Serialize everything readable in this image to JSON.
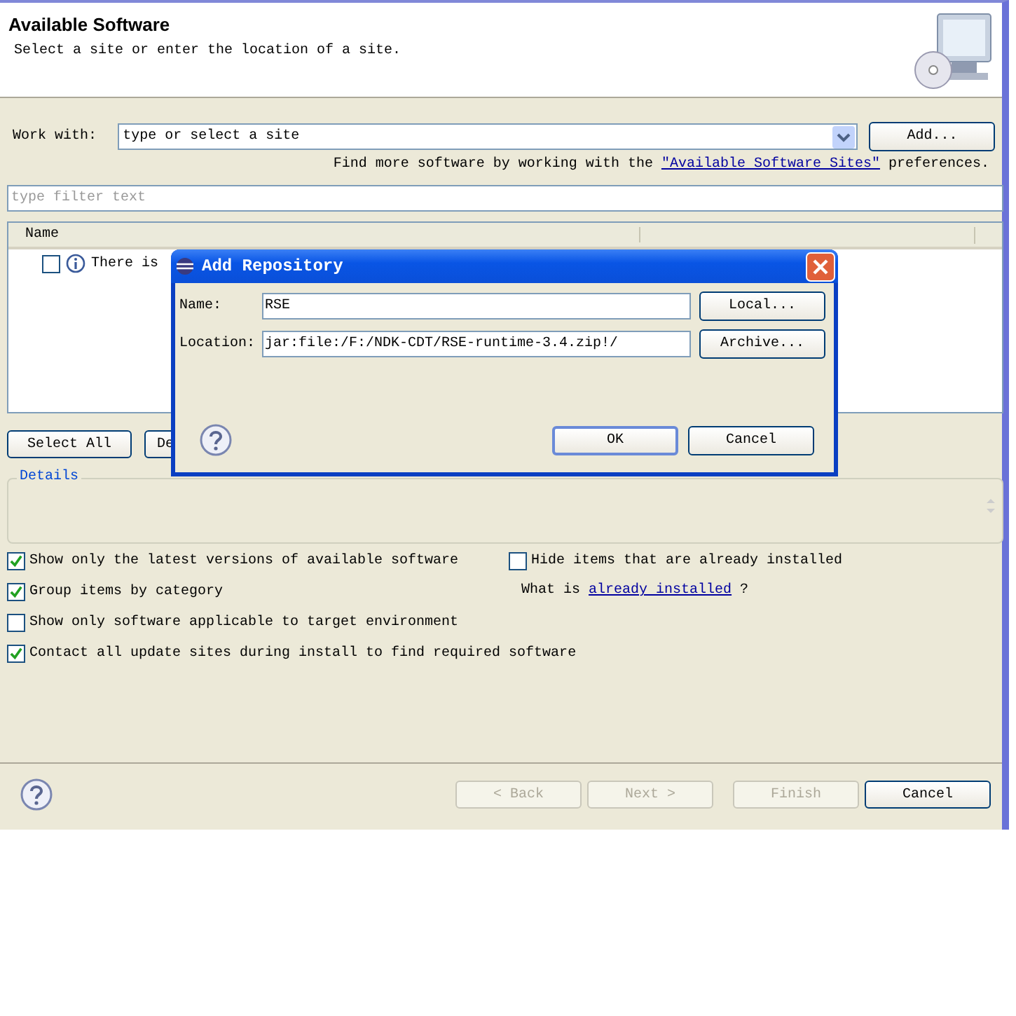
{
  "window": {
    "title": "Available Software",
    "subtitle": "Select a site or enter the location of a site."
  },
  "work_with": {
    "label": "Work with:",
    "placeholder": "type or select a site",
    "add_button": "Add..."
  },
  "more_software": {
    "text": "Find more software by working with the",
    "link": "\"Available Software Sites\"",
    "suffix": "preferences."
  },
  "filter": {
    "placeholder": "type filter text"
  },
  "table": {
    "columns": [
      "Name"
    ],
    "rows": [
      {
        "text": "There is",
        "checked": false
      }
    ]
  },
  "buttons": [
    "Select All",
    "De"
  ],
  "details": {
    "title": "Details"
  },
  "options": [
    {
      "label": "Show only the latest versions of available software",
      "checked": true
    },
    {
      "label": "Group items by category",
      "checked": true
    },
    {
      "label": "Show only software applicable to target environment",
      "checked": false
    },
    {
      "label": "Contact all update sites during install to find required software",
      "checked": true
    }
  ],
  "hide_installed": {
    "label": "Hide items that are already installed",
    "checked": false
  },
  "installed_note": {
    "text": "What is",
    "link": "already installed",
    "suffix": "?"
  },
  "nav_buttons": [
    {
      "label": "< Back",
      "disabled": true
    },
    {
      "label": "Next >",
      "disabled": true
    },
    {
      "label": "Finish",
      "disabled": true
    },
    {
      "label": "Cancel",
      "disabled": false
    }
  ],
  "dialog": {
    "title": "Add Repository",
    "fields": [
      {
        "label": "Name:",
        "value": "RSE",
        "button": "Local..."
      },
      {
        "label": "Location:",
        "value": "jar:file:/F:/NDK-CDT/RSE-runtime-3.4.zip!/",
        "button": "Archive..."
      }
    ],
    "buttons": [
      "OK",
      "Cancel"
    ]
  }
}
